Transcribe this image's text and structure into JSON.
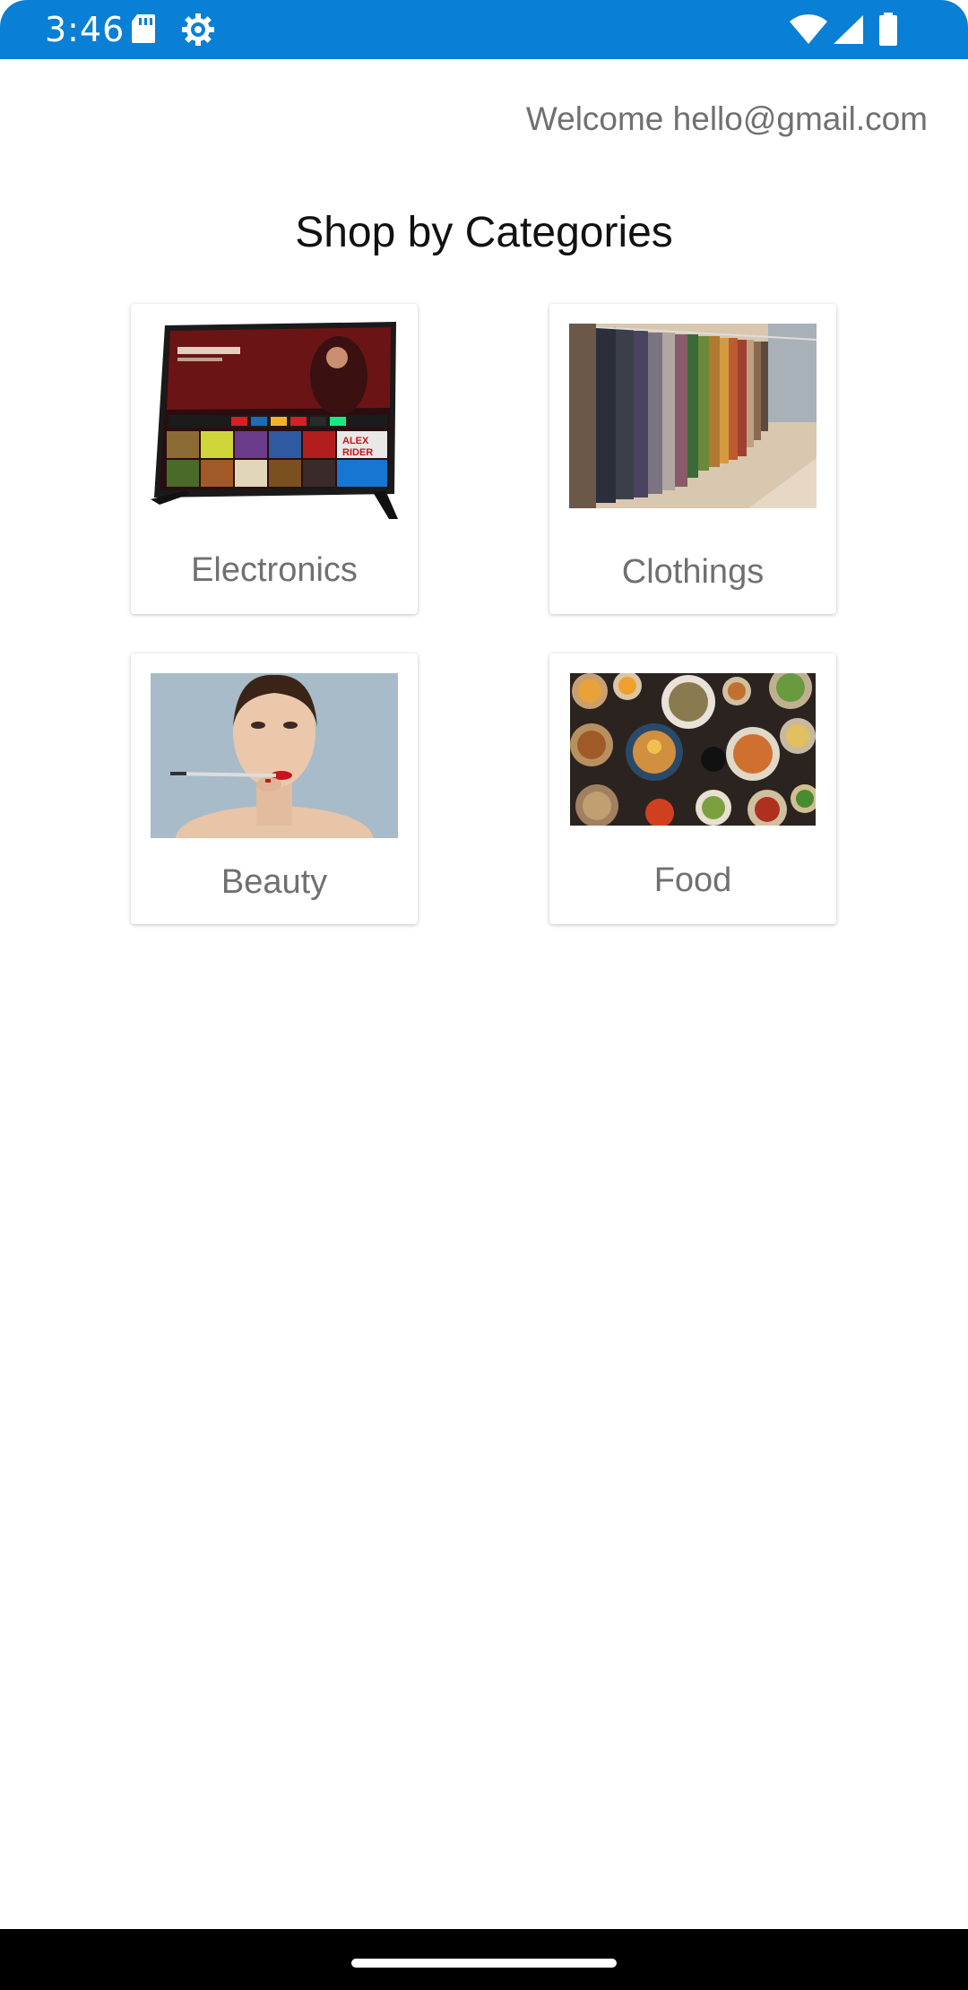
{
  "status_bar": {
    "time": "3:46",
    "icons": [
      "sd-card-icon",
      "settings-gear-icon",
      "wifi-icon",
      "cell-signal-icon",
      "battery-icon"
    ]
  },
  "header": {
    "welcome": "Welcome hello@gmail.com"
  },
  "main": {
    "title": "Shop by Categories",
    "categories": [
      {
        "label": "Electronics",
        "image": "tv-image"
      },
      {
        "label": "Clothings",
        "image": "clothes-rack-image"
      },
      {
        "label": "Beauty",
        "image": "beauty-model-image"
      },
      {
        "label": "Food",
        "image": "food-table-image"
      }
    ]
  },
  "colors": {
    "status_bar": "#0a7fd6",
    "text_gray": "#707070",
    "nav_bar": "#000000"
  }
}
